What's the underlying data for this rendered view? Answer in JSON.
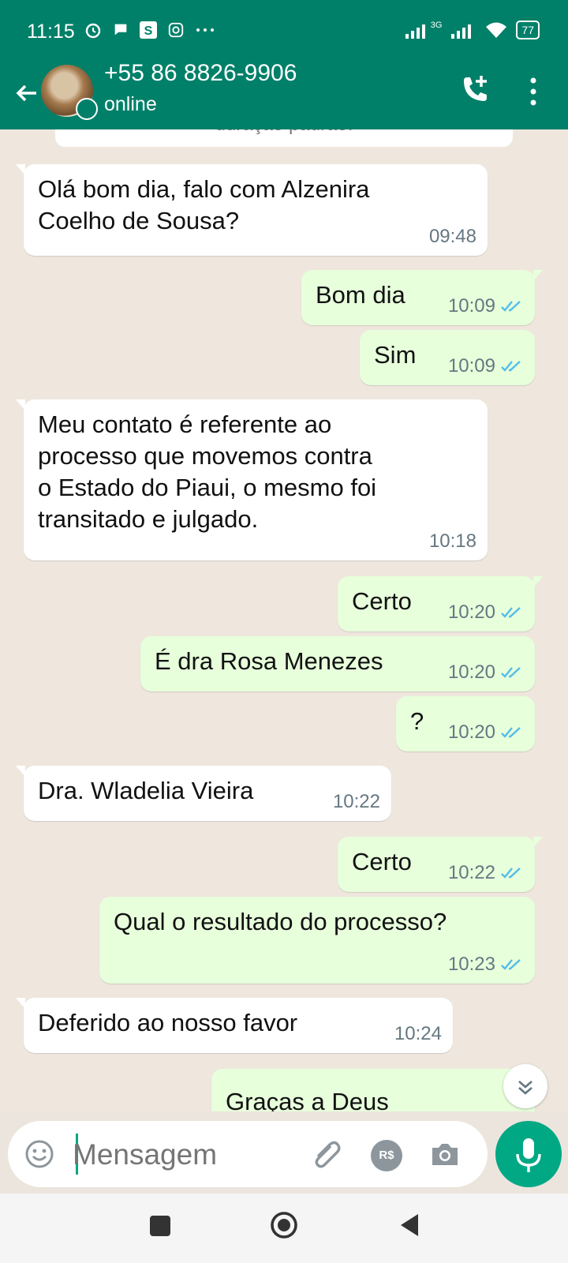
{
  "status_bar": {
    "time": "11:15",
    "network": "3G",
    "battery": "77"
  },
  "header": {
    "contact_name": "+55 86 8826-9906",
    "status": "online"
  },
  "system_message": "duração padrão.",
  "messages": [
    {
      "direction": "in",
      "text": "Olá bom dia, falo com Alzenira",
      "text2": "Coelho de Sousa?",
      "time": "09:48"
    },
    {
      "direction": "out",
      "text": "Bom dia",
      "time": "10:09",
      "read": true
    },
    {
      "direction": "out",
      "text": "Sim",
      "time": "10:09",
      "read": true
    },
    {
      "direction": "in",
      "text": "Meu contato é referente ao",
      "text2": "processo que movemos contra",
      "text3": "o Estado do Piaui, o mesmo foi",
      "text4": "transitado e julgado.",
      "time": "10:18"
    },
    {
      "direction": "out",
      "text": "Certo",
      "time": "10:20",
      "read": true
    },
    {
      "direction": "out",
      "text": "É dra Rosa Menezes",
      "time": "10:20",
      "read": true
    },
    {
      "direction": "out",
      "text": "?",
      "time": "10:20",
      "read": true
    },
    {
      "direction": "in",
      "text": "Dra. Wladelia Vieira",
      "time": "10:22"
    },
    {
      "direction": "out",
      "text": "Certo",
      "time": "10:22",
      "read": true
    },
    {
      "direction": "out",
      "text": "Qual o resultado do processo?",
      "time": "10:23",
      "read": true
    },
    {
      "direction": "in",
      "text": "Deferido ao nosso favor",
      "time": "10:24"
    },
    {
      "direction": "out",
      "text": "Graças a Deus",
      "partial": true
    }
  ],
  "composer": {
    "placeholder": "Mensagem",
    "pay_label": "R$"
  },
  "colors": {
    "header": "#008069",
    "outgoing": "#e7ffdb",
    "incoming": "#ffffff",
    "accent": "#00a884",
    "read_ticks": "#53bdeb"
  },
  "icons": [
    "back-arrow-icon",
    "add-call-icon",
    "more-vert-icon",
    "emoji-icon",
    "attach-icon",
    "camera-icon",
    "mic-icon",
    "chevron-down-icon"
  ]
}
